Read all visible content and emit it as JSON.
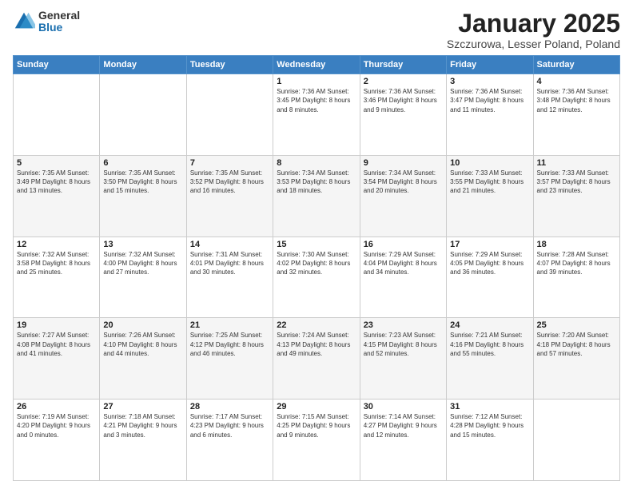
{
  "logo": {
    "general": "General",
    "blue": "Blue"
  },
  "header": {
    "month": "January 2025",
    "location": "Szczurowa, Lesser Poland, Poland"
  },
  "weekdays": [
    "Sunday",
    "Monday",
    "Tuesday",
    "Wednesday",
    "Thursday",
    "Friday",
    "Saturday"
  ],
  "weeks": [
    [
      {
        "day": "",
        "info": ""
      },
      {
        "day": "",
        "info": ""
      },
      {
        "day": "",
        "info": ""
      },
      {
        "day": "1",
        "info": "Sunrise: 7:36 AM\nSunset: 3:45 PM\nDaylight: 8 hours and 8 minutes."
      },
      {
        "day": "2",
        "info": "Sunrise: 7:36 AM\nSunset: 3:46 PM\nDaylight: 8 hours and 9 minutes."
      },
      {
        "day": "3",
        "info": "Sunrise: 7:36 AM\nSunset: 3:47 PM\nDaylight: 8 hours and 11 minutes."
      },
      {
        "day": "4",
        "info": "Sunrise: 7:36 AM\nSunset: 3:48 PM\nDaylight: 8 hours and 12 minutes."
      }
    ],
    [
      {
        "day": "5",
        "info": "Sunrise: 7:35 AM\nSunset: 3:49 PM\nDaylight: 8 hours and 13 minutes."
      },
      {
        "day": "6",
        "info": "Sunrise: 7:35 AM\nSunset: 3:50 PM\nDaylight: 8 hours and 15 minutes."
      },
      {
        "day": "7",
        "info": "Sunrise: 7:35 AM\nSunset: 3:52 PM\nDaylight: 8 hours and 16 minutes."
      },
      {
        "day": "8",
        "info": "Sunrise: 7:34 AM\nSunset: 3:53 PM\nDaylight: 8 hours and 18 minutes."
      },
      {
        "day": "9",
        "info": "Sunrise: 7:34 AM\nSunset: 3:54 PM\nDaylight: 8 hours and 20 minutes."
      },
      {
        "day": "10",
        "info": "Sunrise: 7:33 AM\nSunset: 3:55 PM\nDaylight: 8 hours and 21 minutes."
      },
      {
        "day": "11",
        "info": "Sunrise: 7:33 AM\nSunset: 3:57 PM\nDaylight: 8 hours and 23 minutes."
      }
    ],
    [
      {
        "day": "12",
        "info": "Sunrise: 7:32 AM\nSunset: 3:58 PM\nDaylight: 8 hours and 25 minutes."
      },
      {
        "day": "13",
        "info": "Sunrise: 7:32 AM\nSunset: 4:00 PM\nDaylight: 8 hours and 27 minutes."
      },
      {
        "day": "14",
        "info": "Sunrise: 7:31 AM\nSunset: 4:01 PM\nDaylight: 8 hours and 30 minutes."
      },
      {
        "day": "15",
        "info": "Sunrise: 7:30 AM\nSunset: 4:02 PM\nDaylight: 8 hours and 32 minutes."
      },
      {
        "day": "16",
        "info": "Sunrise: 7:29 AM\nSunset: 4:04 PM\nDaylight: 8 hours and 34 minutes."
      },
      {
        "day": "17",
        "info": "Sunrise: 7:29 AM\nSunset: 4:05 PM\nDaylight: 8 hours and 36 minutes."
      },
      {
        "day": "18",
        "info": "Sunrise: 7:28 AM\nSunset: 4:07 PM\nDaylight: 8 hours and 39 minutes."
      }
    ],
    [
      {
        "day": "19",
        "info": "Sunrise: 7:27 AM\nSunset: 4:08 PM\nDaylight: 8 hours and 41 minutes."
      },
      {
        "day": "20",
        "info": "Sunrise: 7:26 AM\nSunset: 4:10 PM\nDaylight: 8 hours and 44 minutes."
      },
      {
        "day": "21",
        "info": "Sunrise: 7:25 AM\nSunset: 4:12 PM\nDaylight: 8 hours and 46 minutes."
      },
      {
        "day": "22",
        "info": "Sunrise: 7:24 AM\nSunset: 4:13 PM\nDaylight: 8 hours and 49 minutes."
      },
      {
        "day": "23",
        "info": "Sunrise: 7:23 AM\nSunset: 4:15 PM\nDaylight: 8 hours and 52 minutes."
      },
      {
        "day": "24",
        "info": "Sunrise: 7:21 AM\nSunset: 4:16 PM\nDaylight: 8 hours and 55 minutes."
      },
      {
        "day": "25",
        "info": "Sunrise: 7:20 AM\nSunset: 4:18 PM\nDaylight: 8 hours and 57 minutes."
      }
    ],
    [
      {
        "day": "26",
        "info": "Sunrise: 7:19 AM\nSunset: 4:20 PM\nDaylight: 9 hours and 0 minutes."
      },
      {
        "day": "27",
        "info": "Sunrise: 7:18 AM\nSunset: 4:21 PM\nDaylight: 9 hours and 3 minutes."
      },
      {
        "day": "28",
        "info": "Sunrise: 7:17 AM\nSunset: 4:23 PM\nDaylight: 9 hours and 6 minutes."
      },
      {
        "day": "29",
        "info": "Sunrise: 7:15 AM\nSunset: 4:25 PM\nDaylight: 9 hours and 9 minutes."
      },
      {
        "day": "30",
        "info": "Sunrise: 7:14 AM\nSunset: 4:27 PM\nDaylight: 9 hours and 12 minutes."
      },
      {
        "day": "31",
        "info": "Sunrise: 7:12 AM\nSunset: 4:28 PM\nDaylight: 9 hours and 15 minutes."
      },
      {
        "day": "",
        "info": ""
      }
    ]
  ]
}
